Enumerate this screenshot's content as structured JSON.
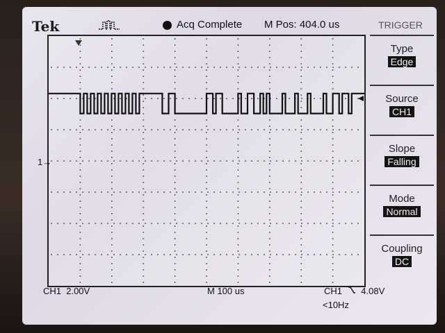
{
  "header": {
    "brand": "Tek",
    "acq_status": "Acq Complete",
    "position": "M Pos: 404.0 us"
  },
  "menu": {
    "title": "TRIGGER",
    "items": [
      {
        "label": "Type",
        "value": "Edge"
      },
      {
        "label": "Source",
        "value": "CH1"
      },
      {
        "label": "Slope",
        "value": "Falling"
      },
      {
        "label": "Mode",
        "value": "Normal"
      },
      {
        "label": "Coupling",
        "value": "DC"
      }
    ]
  },
  "footer": {
    "channel_scale": "CH1  2.00V",
    "time_scale": "M 100 us",
    "trigger_channel": "CH1",
    "trigger_level": "4.08V",
    "trigger_freq": "<10Hz"
  },
  "graticule": {
    "h_divisions": 10,
    "v_divisions": 8
  },
  "marker": {
    "ch1": "1→"
  },
  "waveform": {
    "high_y": 0.23,
    "low_y": 0.31,
    "segments": [
      [
        0.0,
        0.1,
        "h"
      ],
      [
        0.1,
        0.29,
        "toggle"
      ],
      [
        0.29,
        0.36,
        "h"
      ],
      [
        0.36,
        0.38,
        "l"
      ],
      [
        0.38,
        0.4,
        "h"
      ],
      [
        0.4,
        0.5,
        "l"
      ],
      [
        0.5,
        0.52,
        "h"
      ],
      [
        0.52,
        0.53,
        "l"
      ],
      [
        0.53,
        0.55,
        "h"
      ],
      [
        0.55,
        0.6,
        "l"
      ],
      [
        0.6,
        0.61,
        "h"
      ],
      [
        0.61,
        0.63,
        "l"
      ],
      [
        0.63,
        0.65,
        "h"
      ],
      [
        0.65,
        0.67,
        "l"
      ],
      [
        0.67,
        0.68,
        "h"
      ],
      [
        0.68,
        0.69,
        "l"
      ],
      [
        0.69,
        0.7,
        "h"
      ],
      [
        0.7,
        0.74,
        "l"
      ],
      [
        0.74,
        0.75,
        "h"
      ],
      [
        0.75,
        0.78,
        "l"
      ],
      [
        0.78,
        0.79,
        "h"
      ],
      [
        0.79,
        0.82,
        "l"
      ],
      [
        0.82,
        0.83,
        "h"
      ],
      [
        0.83,
        0.87,
        "l"
      ],
      [
        0.87,
        0.88,
        "h"
      ],
      [
        0.88,
        0.9,
        "l"
      ],
      [
        0.9,
        0.92,
        "h"
      ],
      [
        0.92,
        0.93,
        "l"
      ],
      [
        0.93,
        0.95,
        "h"
      ],
      [
        0.95,
        0.96,
        "l"
      ],
      [
        0.96,
        1.0,
        "h"
      ]
    ]
  }
}
